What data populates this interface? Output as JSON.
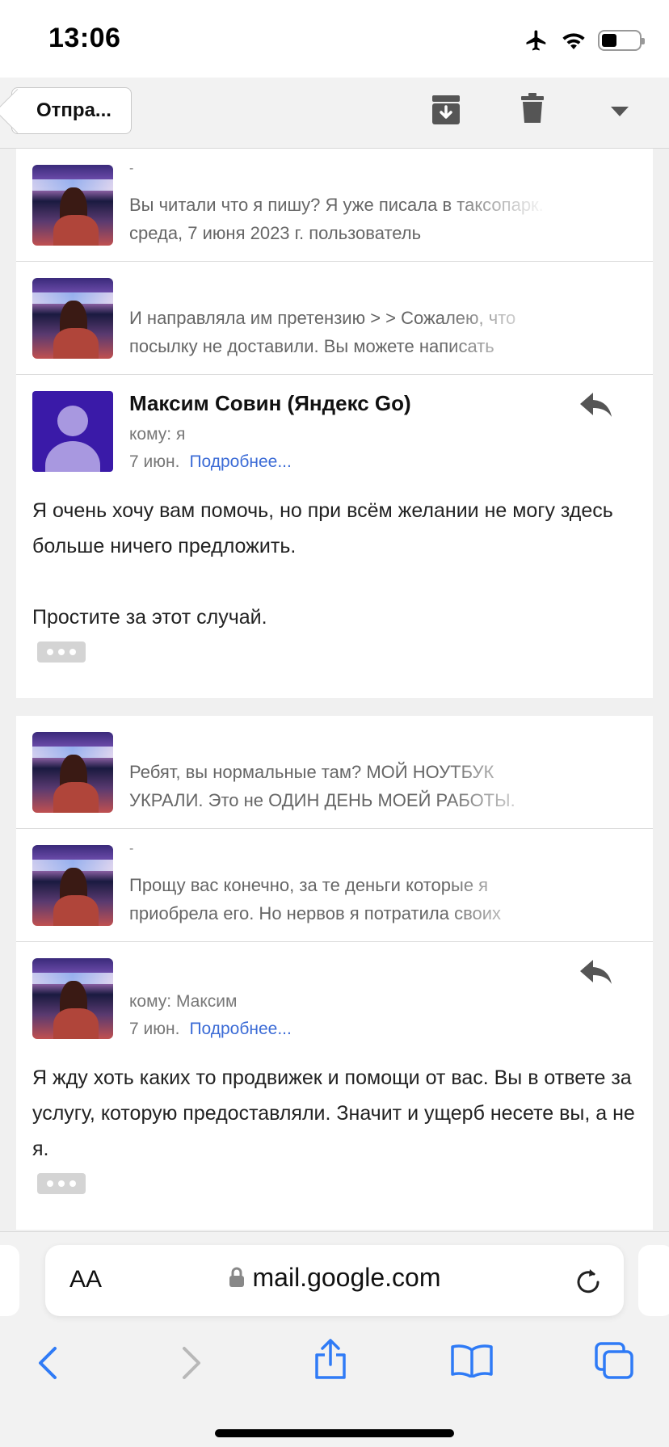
{
  "status_bar": {
    "time": "13:06"
  },
  "toolbar": {
    "back_label": "Отпра..."
  },
  "thread": {
    "group1": {
      "collapsed": [
        {
          "sender": "-",
          "snippet": "Вы читали что я пишу? Я уже писала в таксопарк. среда, 7 июня 2023 г. пользователь"
        },
        {
          "sender": "",
          "snippet": "И направляла им претензию > > Сожалею, что посылку не доставили. Вы можете написать"
        }
      ],
      "expanded": {
        "sender_name": "Максим Совин (Яндекс Go)",
        "recipient": "кому: я",
        "date": "7 июн.",
        "details_link": "Подробнее...",
        "paragraph1": "Я очень хочу вам помочь, но при всём желании не могу здесь больше ничего предложить.",
        "paragraph2": "Простите за этот случай."
      }
    },
    "group2": {
      "collapsed": [
        {
          "sender": "",
          "snippet": "Ребят, вы нормальные там? МОЙ НОУТБУК УКРАЛИ. Это не ОДИН ДЕНЬ МОЕЙ РАБОТЫ."
        },
        {
          "sender": "-",
          "snippet": "Прощу вас конечно, за те деньги которые я приобрела его. Но нервов я потратила своих"
        }
      ],
      "expanded": {
        "sender_name": "",
        "recipient": "кому: Максим",
        "date": "7 июн.",
        "details_link": "Подробнее...",
        "paragraph1": "Я жду хоть каких то продвижек и помощи от вас. Вы в ответе за услугу, которую предоставляли. Значит и ущерб несете вы, а не я."
      }
    }
  },
  "browser": {
    "aa_label": "AA",
    "url": "mail.google.com"
  },
  "colors": {
    "link": "#3b6bd6",
    "avatar_bg": "#3a1aa8",
    "safari_blue": "#2f7bf6"
  }
}
